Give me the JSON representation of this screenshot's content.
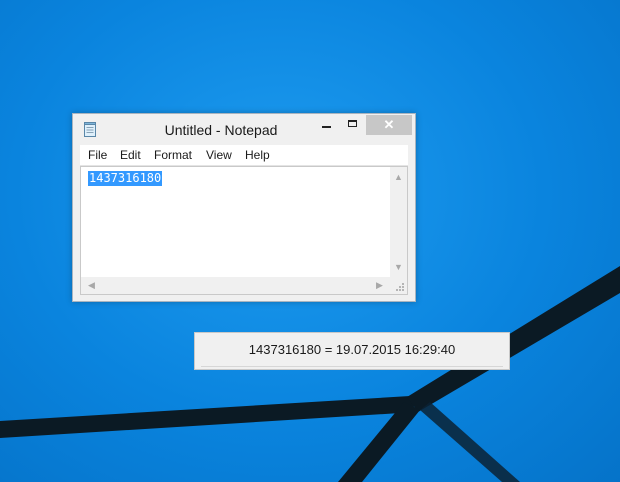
{
  "desktop": {
    "background_color": "#0a84de"
  },
  "notepad": {
    "title": "Untitled - Notepad",
    "menu": [
      "File",
      "Edit",
      "Format",
      "View",
      "Help"
    ],
    "content": "1437316180",
    "close_glyph": "✕",
    "selection_color": "#3399ff"
  },
  "tooltip": {
    "text": "1437316180 = 19.07.2015 16:29:40"
  }
}
